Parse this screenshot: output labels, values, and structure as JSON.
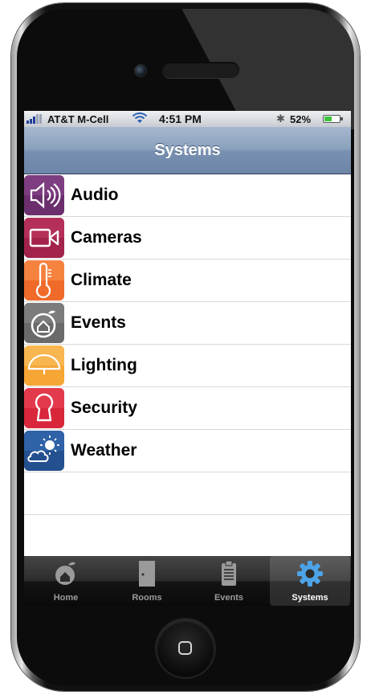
{
  "status": {
    "carrier": "AT&T M-Cell",
    "time": "4:51 PM",
    "battery_percent": "52%",
    "battery_level": 0.52,
    "wifi_icon": "wifi-icon",
    "bluetooth_icon": "bluetooth-icon"
  },
  "nav": {
    "title": "Systems"
  },
  "list": {
    "items": [
      {
        "label": "Audio",
        "icon": "speaker-icon",
        "color": "#6b2f6e"
      },
      {
        "label": "Cameras",
        "icon": "video-camera-icon",
        "color": "#a3234a"
      },
      {
        "label": "Climate",
        "icon": "thermometer-icon",
        "color": "#f06a2a"
      },
      {
        "label": "Events",
        "icon": "house-clock-icon",
        "color": "#6a6a6a"
      },
      {
        "label": "Lighting",
        "icon": "lamp-icon",
        "color": "#f6a634"
      },
      {
        "label": "Security",
        "icon": "keyhole-icon",
        "color": "#d8263a"
      },
      {
        "label": "Weather",
        "icon": "sun-cloud-icon",
        "color": "#24508f"
      }
    ]
  },
  "tabs": [
    {
      "label": "Home",
      "icon": "home-icon",
      "active": false
    },
    {
      "label": "Rooms",
      "icon": "door-icon",
      "active": false
    },
    {
      "label": "Events",
      "icon": "clipboard-icon",
      "active": false
    },
    {
      "label": "Systems",
      "icon": "gear-icon",
      "active": true
    }
  ]
}
